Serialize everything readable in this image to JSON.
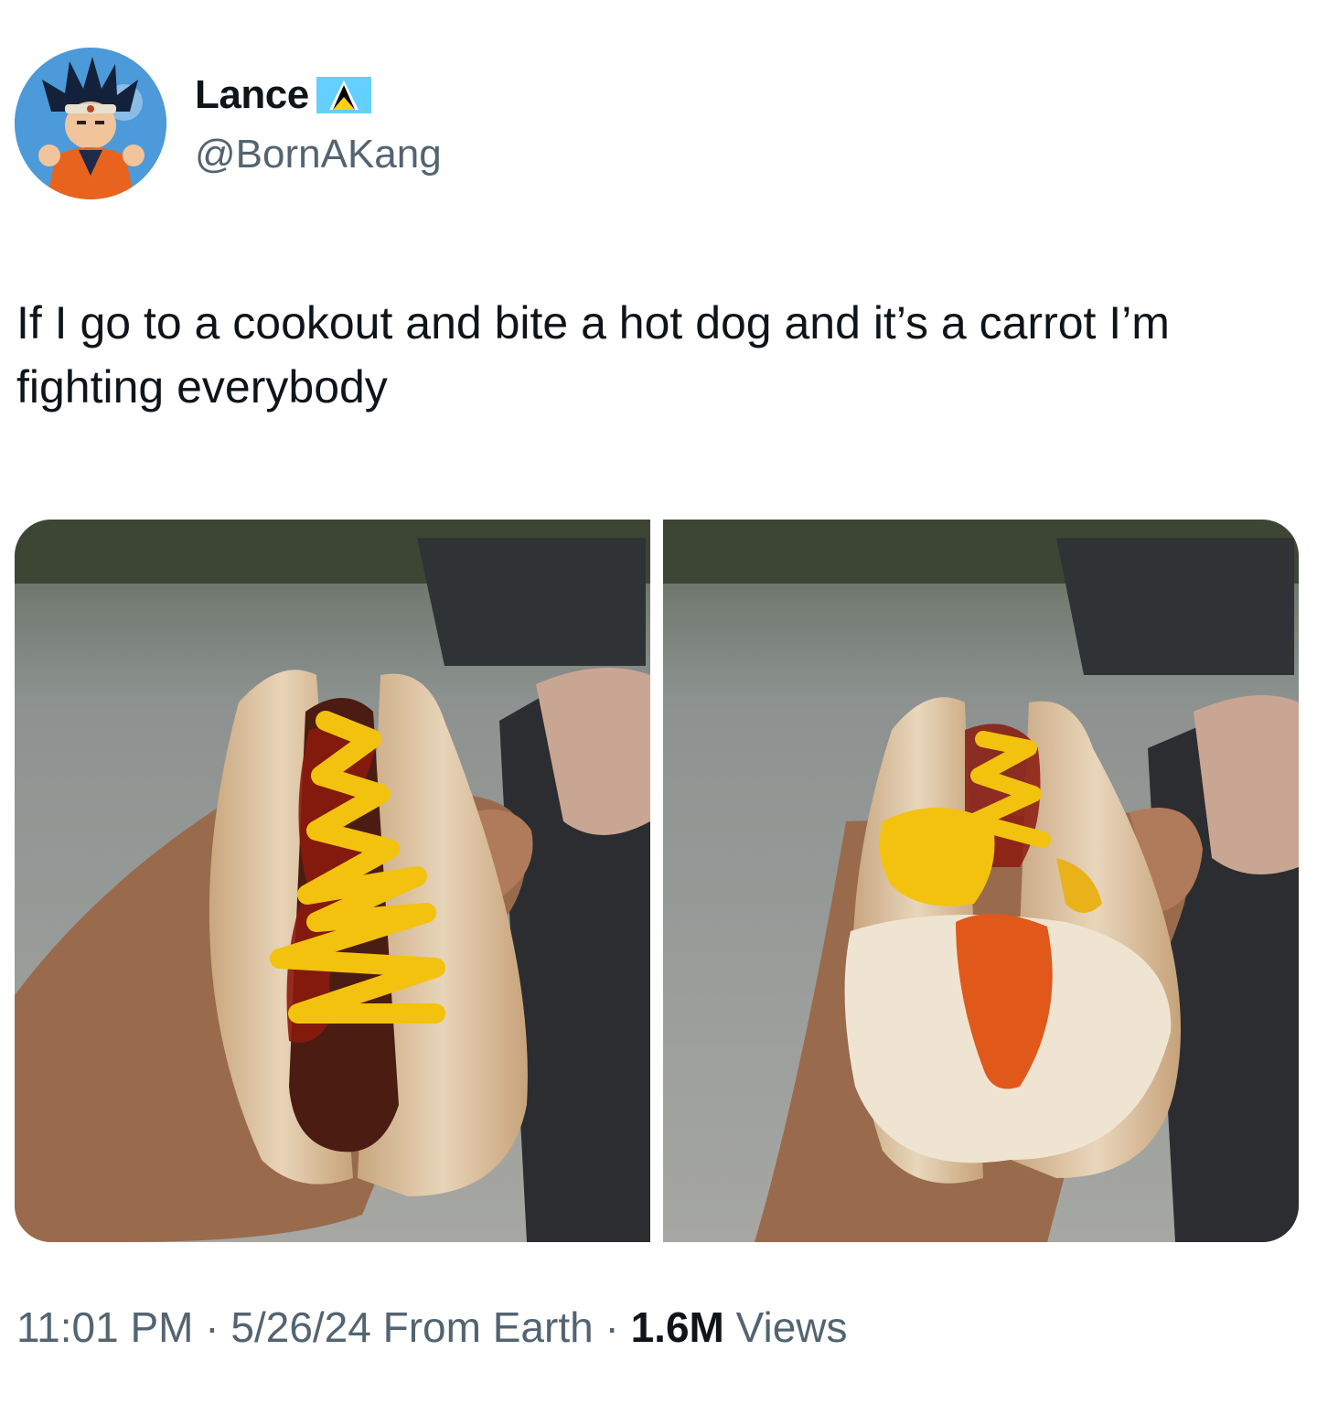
{
  "author": {
    "display_name": "Lance",
    "handle": "@BornAKang",
    "flag_icon": "saint-lucia-flag-icon"
  },
  "tweet": {
    "text": "If I go to a cookout and bite a hot dog and it’s a carrot I’m fighting everybody"
  },
  "media": {
    "count": 2
  },
  "meta": {
    "time": "11:01 PM",
    "separator": " · ",
    "date": "5/26/24",
    "source": "From Earth",
    "views_count": "1.6M",
    "views_label": "Views"
  },
  "colors": {
    "text_primary": "#0f1419",
    "text_secondary": "#536471",
    "background": "#ffffff"
  }
}
